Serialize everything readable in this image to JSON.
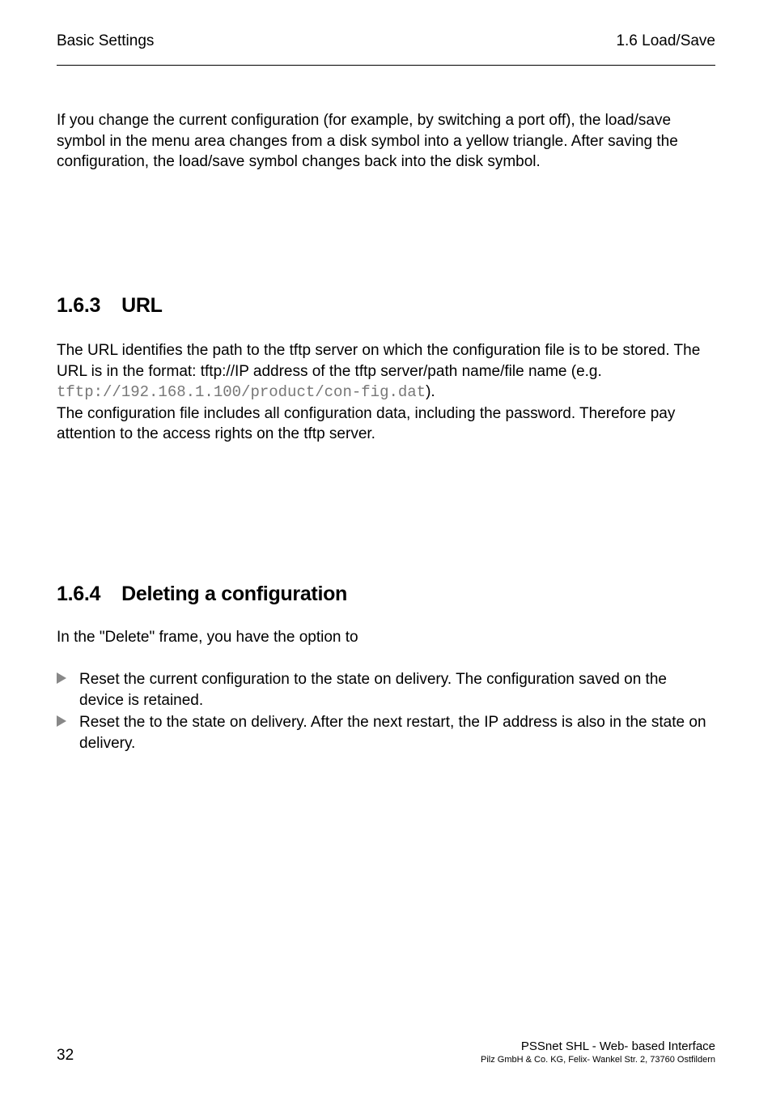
{
  "header": {
    "left": "Basic Settings",
    "right": "1.6  Load/Save"
  },
  "intro": "If you change the current configuration (for example, by switching a port off), the load/save symbol in the menu area changes from a disk symbol into a yellow triangle. After saving the configuration, the load/save symbol changes back into the disk symbol.",
  "section163": {
    "num": "1.6.3",
    "title": "URL",
    "para1_pre": "The URL identifies the path to the tftp server on which the configuration file is to be stored. The URL is in the format: tftp://IP address of the tftp server/path name/file name (e.g. ",
    "code": "tftp://192.168.1.100/product/con-fig.dat",
    "para1_post": ").",
    "para2": "The configuration file includes all configuration data, including the password. Therefore pay attention to the access rights on the tftp server."
  },
  "section164": {
    "num": "1.6.4",
    "title": "Deleting a configuration",
    "lead": "In the \"Delete\" frame, you have the option to",
    "bullets": [
      "Reset the current configuration to the state on delivery. The configuration saved on the device is retained.",
      "Reset the  to the state on delivery. After the next restart, the IP address is also in the state on delivery."
    ]
  },
  "footer": {
    "page": "32",
    "title": "PSSnet SHL - Web- based Interface",
    "company": "Pilz GmbH & Co. KG, Felix- Wankel Str. 2, 73760 Ostfildern"
  }
}
